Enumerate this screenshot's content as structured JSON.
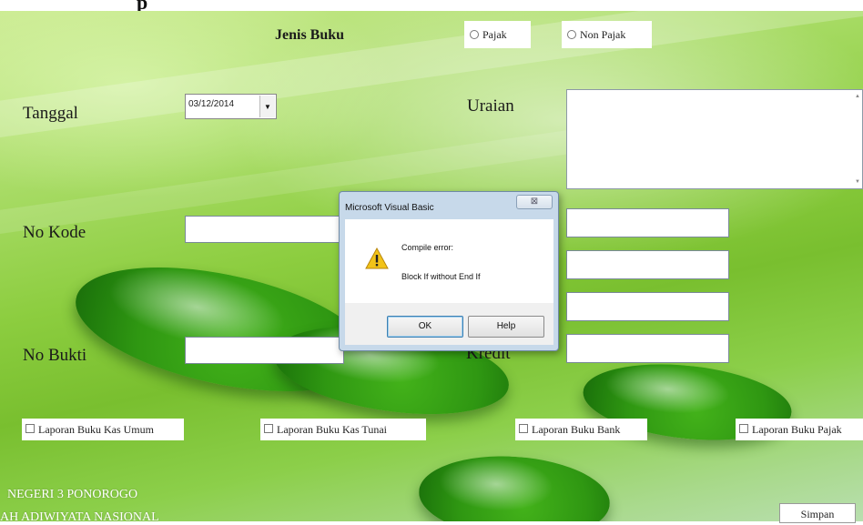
{
  "window": {
    "title_fragment": "p"
  },
  "form": {
    "jenis_buku_label": "Jenis Buku",
    "radio_pajak": "Pajak",
    "radio_non_pajak": "Non Pajak",
    "tanggal_label": "Tanggal",
    "tanggal_value": "03/12/2014",
    "uraian_label": "Uraian",
    "no_kode_label": "No Kode",
    "no_bukti_label": "No Bukti",
    "kredit_label_partial": "Kredit",
    "checkboxes": [
      "Laporan Buku Kas Umum",
      "Laporan Buku Kas Tunai",
      "Laporan Buku Bank",
      "Laporan Buku Pajak"
    ],
    "footer_line1": "NEGERI 3 PONOROGO",
    "footer_line2": "AH ADIWIYATA NASIONAL",
    "simpan_label": "Simpan"
  },
  "dialog": {
    "title": "Microsoft Visual Basic",
    "close_glyph": "⊠",
    "message_line1": "Compile error:",
    "message_line2": "Block If without End If",
    "ok_label": "OK",
    "help_label": "Help"
  },
  "icons": {
    "warning": "warning-icon",
    "dropdown": "chevron-down-icon",
    "close": "close-icon"
  },
  "colors": {
    "background_green": "#8ccd3f",
    "dialog_frame": "#c7d9ea"
  }
}
